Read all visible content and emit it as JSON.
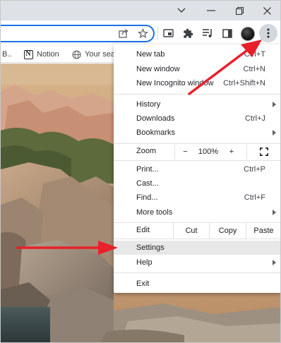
{
  "window": {
    "minimize_icon": "chevron-down-icon",
    "controls": [
      "minimize-icon",
      "restore-icon",
      "close-icon"
    ]
  },
  "toolbar": {
    "icons": [
      "share-icon",
      "star-icon",
      "picture-in-picture-icon",
      "extensions-icon",
      "media-control-icon",
      "side-panel-icon",
      "profile-avatar",
      "kebab-menu-icon"
    ]
  },
  "bookmarks": {
    "partial_label": "B..",
    "items": [
      {
        "label": "Notion",
        "icon": "notion-icon"
      },
      {
        "label": "Your sea",
        "icon": "globe-icon"
      }
    ]
  },
  "menu": {
    "new_tab": {
      "label": "New tab",
      "shortcut": "Ctrl+T"
    },
    "new_window": {
      "label": "New window",
      "shortcut": "Ctrl+N"
    },
    "new_incognito": {
      "label": "New Incognito window",
      "shortcut": "Ctrl+Shift+N"
    },
    "history": {
      "label": "History"
    },
    "downloads": {
      "label": "Downloads",
      "shortcut": "Ctrl+J"
    },
    "bookmarks": {
      "label": "Bookmarks"
    },
    "zoom": {
      "label": "Zoom",
      "minus": "−",
      "value": "100%",
      "plus": "+"
    },
    "print": {
      "label": "Print...",
      "shortcut": "Ctrl+P"
    },
    "cast": {
      "label": "Cast..."
    },
    "find": {
      "label": "Find...",
      "shortcut": "Ctrl+F"
    },
    "more_tools": {
      "label": "More tools"
    },
    "edit": {
      "label": "Edit",
      "cut": "Cut",
      "copy": "Copy",
      "paste": "Paste"
    },
    "settings": {
      "label": "Settings"
    },
    "help": {
      "label": "Help"
    },
    "exit": {
      "label": "Exit"
    }
  },
  "colors": {
    "accent": "#1a73e8",
    "annotation_arrow": "#e8202a",
    "highlight": "#e8e8e8"
  }
}
